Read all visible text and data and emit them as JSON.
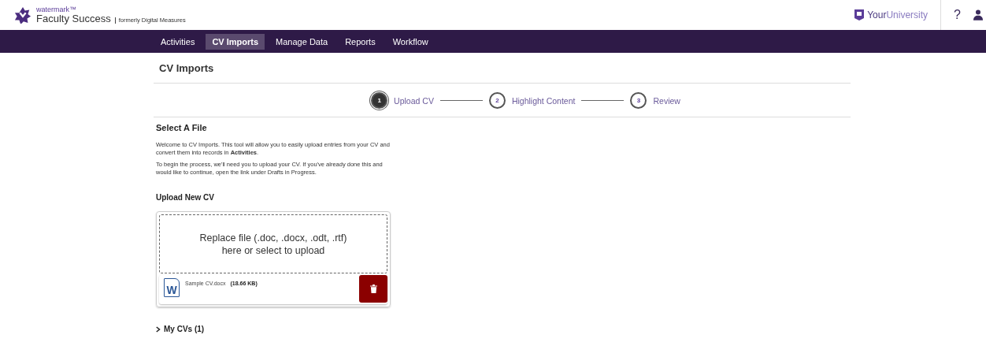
{
  "brand": {
    "name": "watermark™",
    "product": "Faculty Success",
    "tagline": "formerly Digital Measures"
  },
  "header": {
    "university_prefix": "Your",
    "university_suffix": "University",
    "help": "?"
  },
  "nav": [
    {
      "label": "Activities",
      "selected": false
    },
    {
      "label": "CV Imports",
      "selected": true
    },
    {
      "label": "Manage Data",
      "selected": false
    },
    {
      "label": "Reports",
      "selected": false
    },
    {
      "label": "Workflow",
      "selected": false
    }
  ],
  "page_title": "CV Imports",
  "steps": [
    {
      "number": "1",
      "label": "Upload CV",
      "selected": true
    },
    {
      "number": "2",
      "label": "Highlight Content",
      "selected": false
    },
    {
      "number": "3",
      "label": "Review",
      "selected": false
    }
  ],
  "section_title": "Select A File",
  "paragraphs": [
    "Welcome to CV Imports. This tool will allow you to easily upload entries from your CV and convert them into records in **Activities**.",
    "To begin the process, we'll need you to upload your CV. If you've already done this and would like to continue, open the link under Drafts in Progress."
  ],
  "upload_title": "Upload New CV",
  "dropzone": {
    "line1": "Replace file (.doc, .docx, .odt, .rtf)",
    "line2": "here or select to upload"
  },
  "file": {
    "icon_letter": "W",
    "name": "Sample CV.docx",
    "size": "(18.66 KB)"
  },
  "my_cvs": {
    "label": "My CVs (1)",
    "expanded": false
  }
}
